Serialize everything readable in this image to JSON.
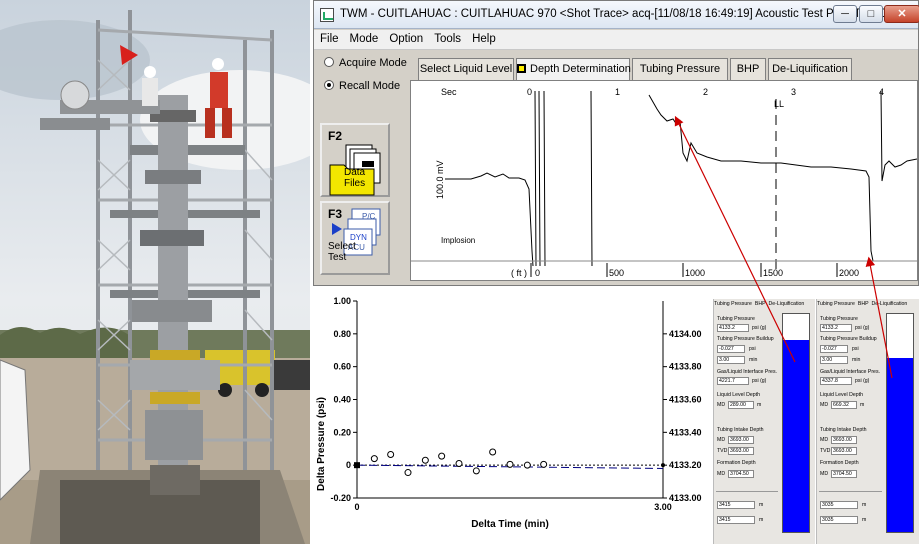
{
  "window": {
    "title": "TWM  -  CUITLAHUAC : CUITLAHUAC 970  <Shot Trace>  acq-[11/08/18 16:49:19]  Acoustic Test POR TP POR IMPLOSION",
    "minimize": "─",
    "maximize": "□",
    "close": "✕"
  },
  "menu": [
    "File",
    "Mode",
    "Option",
    "Tools",
    "Help"
  ],
  "modes": {
    "acquire": "Acquire Mode",
    "recall": "Recall Mode",
    "selected": "recall"
  },
  "fkeys": {
    "f2": {
      "key": "F2",
      "label": "Data Files"
    },
    "f3": {
      "key": "F3",
      "label": "Select Test",
      "doc_labels": [
        "P/C",
        "DYN",
        "ACU"
      ]
    }
  },
  "tabs": [
    "Select Liquid Level",
    "Depth Determination",
    "Tubing Pressure",
    "BHP",
    "De-Liquification"
  ],
  "active_tab": "Depth Determination",
  "trace": {
    "sec_label": "Sec",
    "sec_ticks": [
      "0",
      "1",
      "2",
      "3",
      "4"
    ],
    "ll_label": "LL",
    "y_label": "100.0 mV",
    "implosion_label": "Implosion",
    "ft_label": "( ft )",
    "ft_ticks": [
      "0",
      "500",
      "1000",
      "1500",
      "2000"
    ]
  },
  "chart_data": {
    "type": "scatter",
    "ylabel": "Delta Pressure (psi)",
    "xlabel": "Delta Time (min)",
    "xlim": [
      0,
      3
    ],
    "ylim": [
      -0.2,
      1.0
    ],
    "y_ticks": [
      "1.00",
      "0.80",
      "0.60",
      "0.40",
      "0.20",
      "0",
      "-0.20"
    ],
    "x_ticks": [
      "0",
      "3.00"
    ],
    "y2lim": [
      4133.0,
      4134.2
    ],
    "y2_ticks": [
      "4134.00",
      "4133.80",
      "4133.60",
      "4133.40",
      "4133.20",
      "4133.00"
    ],
    "grid": false,
    "points": [
      [
        0.17,
        0.04
      ],
      [
        0.33,
        0.065
      ],
      [
        0.5,
        -0.045
      ],
      [
        0.67,
        0.03
      ],
      [
        0.83,
        0.055
      ],
      [
        1.0,
        0.01
      ],
      [
        1.17,
        -0.035
      ],
      [
        1.33,
        0.08
      ],
      [
        1.5,
        0.005
      ],
      [
        1.67,
        0.0
      ],
      [
        1.83,
        0.005
      ]
    ],
    "trend": [
      [
        0,
        0.0
      ],
      [
        3.0,
        -0.02
      ]
    ]
  },
  "panel_left": {
    "tabs": [
      "Tubing Pressure",
      "BHP",
      "De-Liquification"
    ],
    "tubing_pressure_label": "Tubing Pressure",
    "tubing_pressure": "4133.2",
    "tubing_pressure_unit": "psi (g)",
    "buildup_label": "Tubing Pressure Buildup",
    "buildup": "-0.027",
    "buildup_unit": "psi",
    "buildup_time": "3.00",
    "buildup_time_unit": "min",
    "gl_interface_label": "Gas/Liquid Interface Pres.",
    "gl_interface": "4221.7",
    "gl_interface_unit": "psi (g)",
    "liquid_level_label": "Liquid Level Depth",
    "md_label": "MD",
    "liquid_level": "289.00",
    "liquid_level_unit": "m",
    "intake_label": "Tubing Intake Depth",
    "intake_md": "3693.00",
    "tvd_label": "TVD",
    "intake_tvd": "3693.00",
    "formation_label": "Formation Depth",
    "formation_md": "3704.50",
    "bottom_values": [
      "3415",
      "3415"
    ],
    "bottom_unit": "m",
    "gauge_fill": 0.88
  },
  "panel_right": {
    "tabs": [
      "Tubing Pressure",
      "BHP",
      "De-Liquification"
    ],
    "tubing_pressure_label": "Tubing Pressure",
    "tubing_pressure": "4133.2",
    "tubing_pressure_unit": "psi (g)",
    "buildup_label": "Tubing Pressure Buildup",
    "buildup": "-0.027",
    "buildup_unit": "psi",
    "buildup_time": "3.00",
    "buildup_time_unit": "min",
    "gl_interface_label": "Gas/Liquid Interface Pres.",
    "gl_interface": "4337.8",
    "gl_interface_unit": "psi (g)",
    "liquid_level_label": "Liquid Level Depth",
    "md_label": "MD",
    "liquid_level": "669.32",
    "liquid_level_unit": "m",
    "intake_label": "Tubing Intake Depth",
    "intake_md": "3693.00",
    "tvd_label": "TVD",
    "intake_tvd": "3693.00",
    "formation_label": "Formation Depth",
    "formation_md": "3704.50",
    "bottom_values": [
      "3035",
      "3035"
    ],
    "bottom_unit": "m",
    "gauge_fill": 0.8
  },
  "colors": {
    "arrow": "#cc0000",
    "gauge": "#0000ff",
    "marker": "#ffef00",
    "trend": "#000080"
  }
}
